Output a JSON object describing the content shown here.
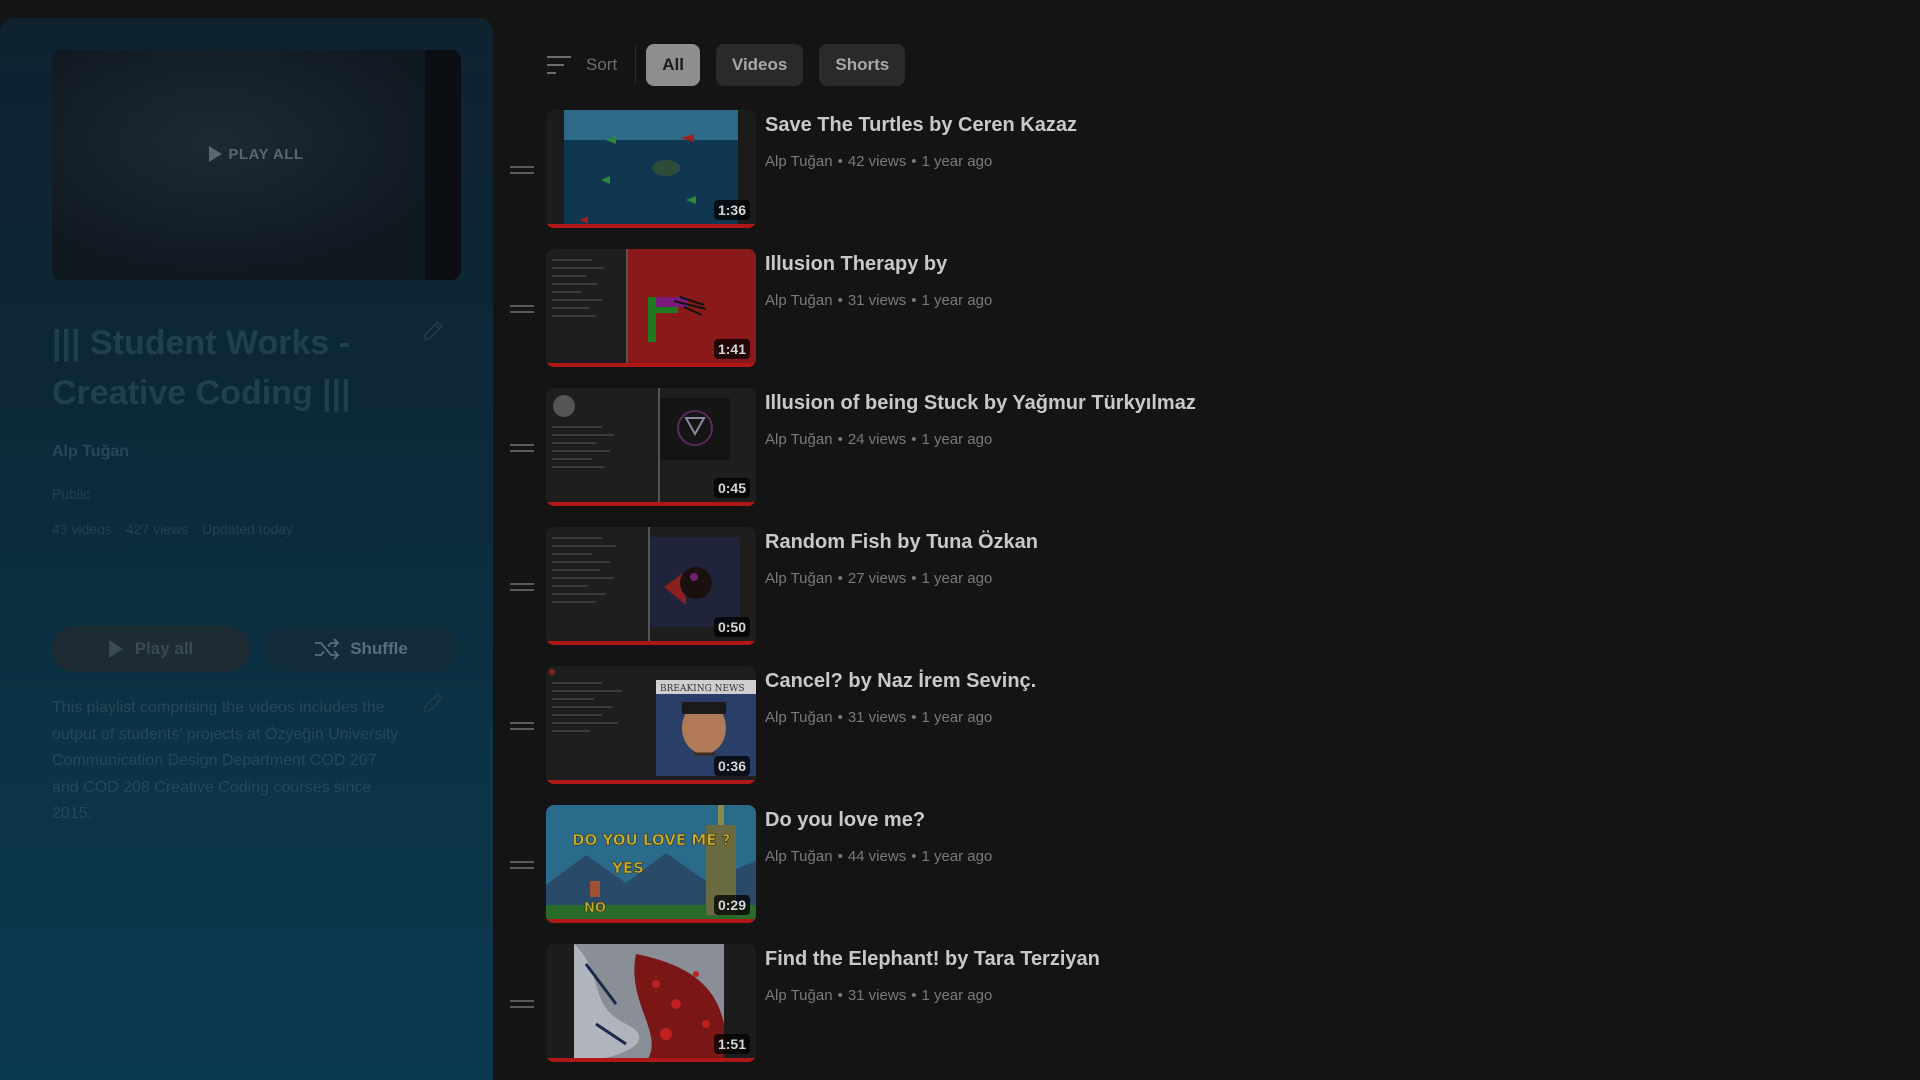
{
  "playlist": {
    "hero_overlay": "PLAY ALL",
    "title": "||| Student Works - Creative Coding |||",
    "owner": "Alp Tuğan",
    "visibility": "Public",
    "stats": [
      "43 videos",
      "427 views",
      "Updated today"
    ],
    "misc": "",
    "play_all_label": "Play all",
    "shuffle_label": "Shuffle",
    "description": "This playlist comprising the videos includes the output of students' projects at Özyeğin University Communication Design Department COD 207 and COD 208 Creative Coding courses since 2015."
  },
  "filters": {
    "sort_label": "Sort",
    "chips": [
      "All",
      "Videos",
      "Shorts"
    ],
    "active": "All"
  },
  "videos": [
    {
      "title": "Save The Turtles by Ceren Kazaz",
      "channel": "Alp Tuğan",
      "views": "42 views",
      "age": "1 year ago",
      "duration": "1:36",
      "thumb": "ocean"
    },
    {
      "title": "Illusion Therapy by",
      "channel": "Alp Tuğan",
      "views": "31 views",
      "age": "1 year ago",
      "duration": "1:41",
      "thumb": "red-code"
    },
    {
      "title": "Illusion of being Stuck by Yağmur Türkyılmaz",
      "channel": "Alp Tuğan",
      "views": "24 views",
      "age": "1 year ago",
      "duration": "0:45",
      "thumb": "dark-code"
    },
    {
      "title": "Random Fish by Tuna Özkan",
      "channel": "Alp Tuğan",
      "views": "27 views",
      "age": "1 year ago",
      "duration": "0:50",
      "thumb": "fish-code"
    },
    {
      "title": "Cancel? by Naz İrem Sevinç.",
      "channel": "Alp Tuğan",
      "views": "31 views",
      "age": "1 year ago",
      "duration": "0:36",
      "thumb": "breaking-news"
    },
    {
      "title": "Do you love me?",
      "channel": "Alp Tuğan",
      "views": "44 views",
      "age": "1 year ago",
      "duration": "0:29",
      "thumb": "pixel-game"
    },
    {
      "title": "Find the Elephant! by Tara Terziyan",
      "channel": "Alp Tuğan",
      "views": "31 views",
      "age": "1 year ago",
      "duration": "1:51",
      "thumb": "paint"
    }
  ],
  "thumb_text": {
    "breaking": "BREAKING NEWS",
    "question": "DO YOU LOVE ME ?",
    "yes": "YES",
    "no": "NO"
  },
  "colors": {
    "progress_bar": "#b01818",
    "panel_gradient_end": "#0b394f"
  }
}
